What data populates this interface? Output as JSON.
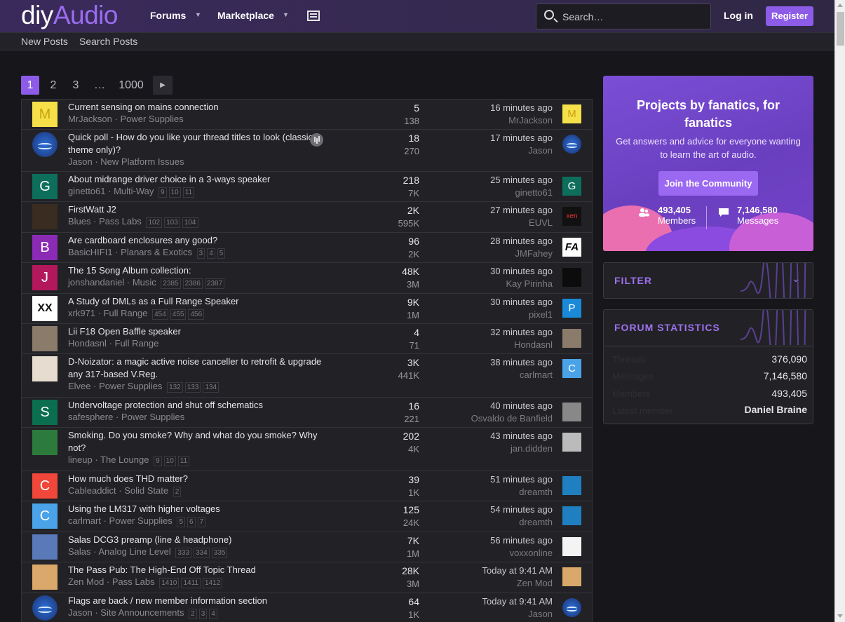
{
  "header": {
    "logo_part1": "diy",
    "logo_part2": "Audio",
    "nav": [
      {
        "label": "Forums"
      },
      {
        "label": "Marketplace"
      }
    ],
    "search_placeholder": "Search…",
    "login_label": "Log in",
    "register_label": "Register"
  },
  "subnav": {
    "new_posts": "New Posts",
    "search_posts": "Search Posts"
  },
  "pagination": {
    "pages": [
      "1",
      "2",
      "3",
      "…",
      "1000"
    ],
    "current": "1"
  },
  "threads": [
    {
      "title": "Current sensing on mains connection",
      "author": "MrJackson",
      "forum": "Power Supplies",
      "pages": [],
      "replies": "5",
      "views": "138",
      "time": "16 minutes ago",
      "last_poster": "MrJackson",
      "avatar_letter": "M",
      "last_letter": "M"
    },
    {
      "title": "Quick poll - How do you like your thread titles to look (classic theme only)?",
      "author": "Jason",
      "forum": "New Platform Issues",
      "pages": [],
      "replies": "18",
      "views": "270",
      "time": "17 minutes ago",
      "last_poster": "Jason",
      "avatar_letter": "",
      "last_letter": ""
    },
    {
      "title": "About midrange driver choice in a 3-ways speaker",
      "author": "ginetto61",
      "forum": "Multi-Way",
      "pages": [
        "9",
        "10",
        "11"
      ],
      "replies": "218",
      "views": "7K",
      "time": "25 minutes ago",
      "last_poster": "ginetto61",
      "avatar_letter": "G",
      "last_letter": "G"
    },
    {
      "title": "FirstWatt J2",
      "author": "Blues",
      "forum": "Pass Labs",
      "pages": [
        "102",
        "103",
        "104"
      ],
      "replies": "2K",
      "views": "595K",
      "time": "27 minutes ago",
      "last_poster": "EUVL",
      "avatar_letter": "",
      "last_letter": "xen"
    },
    {
      "title": "Are cardboard enclosures any good?",
      "author": "BasicHIFI1",
      "forum": "Planars & Exotics",
      "pages": [
        "3",
        "4",
        "5"
      ],
      "replies": "96",
      "views": "2K",
      "time": "28 minutes ago",
      "last_poster": "JMFahey",
      "avatar_letter": "B",
      "last_letter": "FA"
    },
    {
      "title": "The 15 Song Album collection:",
      "author": "jonshandaniel",
      "forum": "Music",
      "pages": [
        "2385",
        "2386",
        "2387"
      ],
      "replies": "48K",
      "views": "3M",
      "time": "30 minutes ago",
      "last_poster": "Kay Pirinha",
      "avatar_letter": "J",
      "last_letter": ""
    },
    {
      "title": "A Study of DMLs as a Full Range Speaker",
      "author": "xrk971",
      "forum": "Full Range",
      "pages": [
        "454",
        "455",
        "456"
      ],
      "replies": "9K",
      "views": "1M",
      "time": "30 minutes ago",
      "last_poster": "pixel1",
      "avatar_letter": "XX",
      "last_letter": "P"
    },
    {
      "title": "Lii F18 Open Baffle speaker",
      "author": "Hondasnl",
      "forum": "Full Range",
      "pages": [],
      "replies": "4",
      "views": "71",
      "time": "32 minutes ago",
      "last_poster": "Hondasnl",
      "avatar_letter": "",
      "last_letter": ""
    },
    {
      "title": "D-Noizator: a magic active noise canceller to retrofit & upgrade any 317-based V.Reg.",
      "author": "Elvee",
      "forum": "Power Supplies",
      "pages": [
        "132",
        "133",
        "134"
      ],
      "replies": "3K",
      "views": "441K",
      "time": "38 minutes ago",
      "last_poster": "carlmart",
      "avatar_letter": "",
      "last_letter": "C"
    },
    {
      "title": "Undervoltage protection and shut off schematics",
      "author": "safesphere",
      "forum": "Power Supplies",
      "pages": [],
      "replies": "16",
      "views": "221",
      "time": "40 minutes ago",
      "last_poster": "Osvaldo de Banfield",
      "avatar_letter": "S",
      "last_letter": ""
    },
    {
      "title": "Smoking. Do you smoke? Why and what do you smoke? Why not?",
      "author": "lineup",
      "forum": "The Lounge",
      "pages": [
        "9",
        "10",
        "11"
      ],
      "replies": "202",
      "views": "4K",
      "time": "43 minutes ago",
      "last_poster": "jan.didden",
      "avatar_letter": "",
      "last_letter": ""
    },
    {
      "title": "How much does THD matter?",
      "author": "Cableaddict",
      "forum": "Solid State",
      "pages": [
        "2"
      ],
      "replies": "39",
      "views": "1K",
      "time": "51 minutes ago",
      "last_poster": "dreamth",
      "avatar_letter": "C",
      "last_letter": ""
    },
    {
      "title": "Using the LM317 with higher voltages",
      "author": "carlmart",
      "forum": "Power Supplies",
      "pages": [
        "5",
        "6",
        "7"
      ],
      "replies": "125",
      "views": "24K",
      "time": "54 minutes ago",
      "last_poster": "dreamth",
      "avatar_letter": "C",
      "last_letter": ""
    },
    {
      "title": "Salas DCG3 preamp (line & headphone)",
      "author": "Salas",
      "forum": "Analog Line Level",
      "pages": [
        "333",
        "334",
        "335"
      ],
      "replies": "7K",
      "views": "1M",
      "time": "56 minutes ago",
      "last_poster": "voxxonline",
      "avatar_letter": "",
      "last_letter": ""
    },
    {
      "title": "The Pass Pub: The High-End Off Topic Thread",
      "author": "Zen Mod",
      "forum": "Pass Labs",
      "pages": [
        "1410",
        "1411",
        "1412"
      ],
      "replies": "28K",
      "views": "3M",
      "time": "Today at 9:41 AM",
      "last_poster": "Zen Mod",
      "avatar_letter": "",
      "last_letter": ""
    },
    {
      "title": "Flags are back / new member information section",
      "author": "Jason",
      "forum": "Site Announcements",
      "pages": [
        "2",
        "3",
        "4"
      ],
      "replies": "64",
      "views": "1K",
      "time": "Today at 9:41 AM",
      "last_poster": "Jason",
      "avatar_letter": "",
      "last_letter": ""
    }
  ],
  "promo": {
    "title": "Projects by fanatics, for fanatics",
    "subtitle": "Get answers and advice for everyone wanting to learn the art of audio.",
    "join_label": "Join the Community",
    "members_count": "493,405",
    "members_label": "Members",
    "messages_count": "7,146,580",
    "messages_label": "Messages"
  },
  "filter": {
    "title": "FILTER"
  },
  "forum_statistics": {
    "title": "FORUM STATISTICS",
    "rows": [
      {
        "label": "Threads",
        "value": "376,090"
      },
      {
        "label": "Messages",
        "value": "7,146,580"
      },
      {
        "label": "Members",
        "value": "493,405"
      },
      {
        "label": "Latest member",
        "value": "Daniel Braine"
      }
    ]
  },
  "colors": {
    "accent": "#8c5ce8",
    "header_bg": "#3a2a5c",
    "body_bg": "#17171b"
  }
}
